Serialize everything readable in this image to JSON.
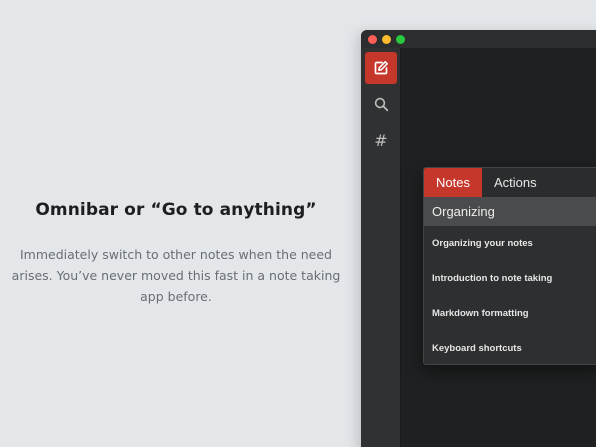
{
  "promo": {
    "title": "Omnibar or “Go to anything”",
    "description": "Immediately switch to other notes when the need arises. You’ve never moved this fast in a note taking app before."
  },
  "window": {
    "controls": [
      "close",
      "minimize",
      "zoom"
    ]
  },
  "sidebar": {
    "buttons": [
      {
        "icon": "compose-icon",
        "active": true
      },
      {
        "icon": "search-icon",
        "active": false
      },
      {
        "icon": "hash-icon",
        "glyph": "#",
        "active": false
      }
    ]
  },
  "omnibar": {
    "tabs": [
      {
        "label": "Notes",
        "active": true
      },
      {
        "label": "Actions",
        "active": false
      }
    ],
    "query": "Organizing",
    "results": [
      "Organizing your notes",
      "Introduction to note taking",
      "Markdown formatting",
      "Keyboard shortcuts"
    ]
  },
  "colors": {
    "accent": "#c5362b",
    "background": "#e3e7ea",
    "window_bg": "#232425",
    "sidebar_bg": "#303132",
    "omnibar_bg": "#2e2f30",
    "input_bg": "#4a4b4c"
  }
}
